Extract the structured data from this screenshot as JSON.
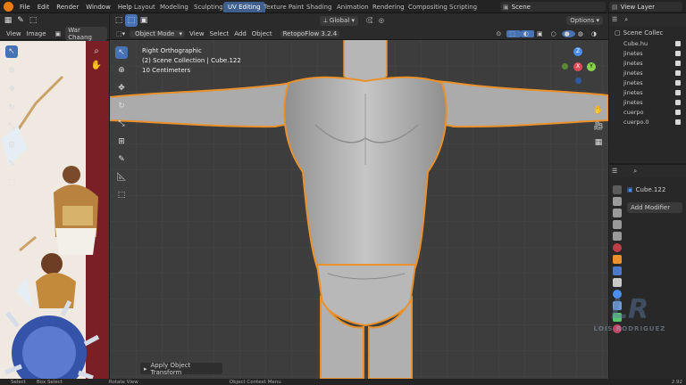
{
  "topbar": {
    "menus": [
      "File",
      "Edit",
      "Render",
      "Window",
      "Help"
    ],
    "workspaces": [
      "Layout",
      "Modeling",
      "Sculpting",
      "UV Editing",
      "Texture Paint",
      "Shading",
      "Animation",
      "Rendering",
      "Compositing",
      "Scripting"
    ],
    "active_workspace": "UV Editing",
    "scene": "Scene",
    "view_layer": "View Layer"
  },
  "image_editor": {
    "menus": [
      "View",
      "Image"
    ],
    "image_name": "War Chaang"
  },
  "viewport": {
    "mode": "Object Mode",
    "menus": [
      "View",
      "Select",
      "Add",
      "Object"
    ],
    "addon": "RetopoFlow 3.2.4",
    "transform": "Global",
    "options": "Options",
    "overlay_view": "Right Orthographic",
    "overlay_collection": "(2) Scene Collection | Cube.122",
    "overlay_scale": "10 Centimeters",
    "last_operator": "Apply Object Transform",
    "gizmo_axes": [
      "Z",
      "Y",
      "X"
    ]
  },
  "outliner": {
    "header": "Scene Collec",
    "items": [
      "Cube.hu",
      "jinetes",
      "jinetes",
      "jinetes",
      "jinetes",
      "jinetes",
      "jinetes",
      "cuerpo",
      "cuerpo.0"
    ]
  },
  "properties": {
    "object_name": "Cube.122",
    "add_modifier": "Add Modifier"
  },
  "watermark": {
    "monogram": "LR",
    "name": "LOIS RODRIGUEZ"
  },
  "statusbar": {
    "items": [
      "Select",
      "Box Select",
      "Rotate View",
      "Object Context Menu"
    ],
    "version": "2.92"
  },
  "colors": {
    "accent": "#4772b3",
    "selection_outline": "#e8912d",
    "viewport_bg": "#3d3d3d",
    "grid_line": "#464646",
    "axis_x": "#e04a5b",
    "axis_y": "#8bd24b",
    "axis_z": "#4b8ef0"
  }
}
